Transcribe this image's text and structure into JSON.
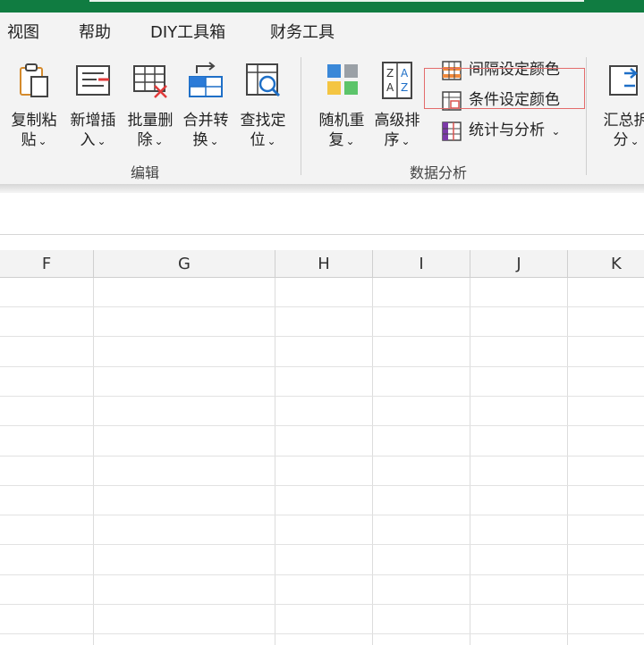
{
  "menu": [
    "视图",
    "帮助",
    "DIY工具箱",
    "财务工具"
  ],
  "edit_group": {
    "label": "编辑",
    "buttons": [
      {
        "line1": "复制粘",
        "line2": "贴"
      },
      {
        "line1": "新增插",
        "line2": "入"
      },
      {
        "line1": "批量删",
        "line2": "除"
      },
      {
        "line1": "合并转",
        "line2": "换"
      },
      {
        "line1": "查找定",
        "line2": "位"
      }
    ]
  },
  "data_group": {
    "label": "数据分析",
    "buttons": [
      {
        "line1": "随机重",
        "line2": "复"
      },
      {
        "line1": "高级排",
        "line2": "序"
      }
    ],
    "small_buttons": [
      "间隔设定颜色",
      "条件设定颜色",
      "统计与分析"
    ]
  },
  "partial_button": {
    "line1": "汇总拆",
    "line2": "分"
  },
  "caret": "⌄",
  "columns": [
    "F",
    "G",
    "H",
    "I",
    "J",
    "K"
  ],
  "colors": {
    "accent": "#107c41",
    "highlight_border": "#e36b6b"
  }
}
